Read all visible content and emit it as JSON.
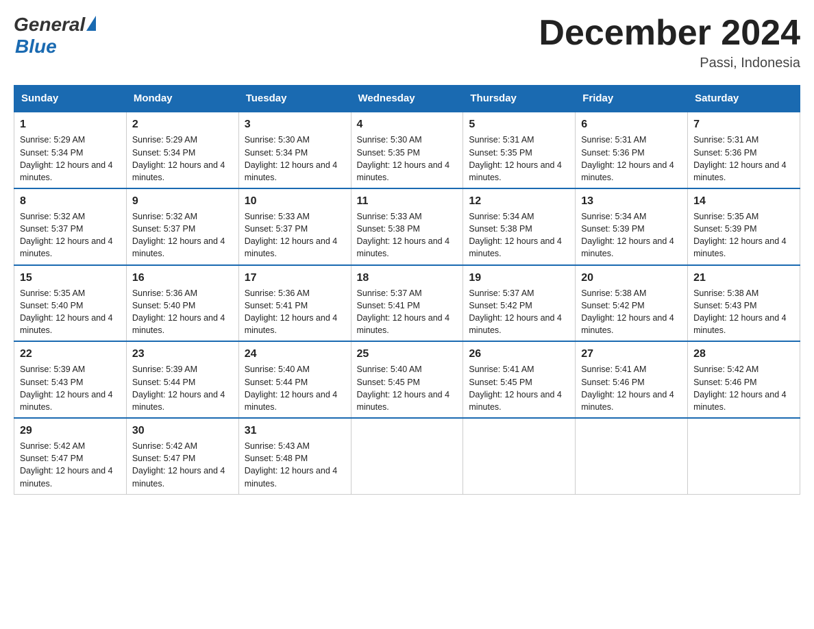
{
  "header": {
    "logo_general": "General",
    "logo_blue": "Blue",
    "month_title": "December 2024",
    "location": "Passi, Indonesia"
  },
  "days_of_week": [
    "Sunday",
    "Monday",
    "Tuesday",
    "Wednesday",
    "Thursday",
    "Friday",
    "Saturday"
  ],
  "weeks": [
    [
      {
        "day": "1",
        "sunrise": "5:29 AM",
        "sunset": "5:34 PM",
        "daylight": "12 hours and 4 minutes."
      },
      {
        "day": "2",
        "sunrise": "5:29 AM",
        "sunset": "5:34 PM",
        "daylight": "12 hours and 4 minutes."
      },
      {
        "day": "3",
        "sunrise": "5:30 AM",
        "sunset": "5:34 PM",
        "daylight": "12 hours and 4 minutes."
      },
      {
        "day": "4",
        "sunrise": "5:30 AM",
        "sunset": "5:35 PM",
        "daylight": "12 hours and 4 minutes."
      },
      {
        "day": "5",
        "sunrise": "5:31 AM",
        "sunset": "5:35 PM",
        "daylight": "12 hours and 4 minutes."
      },
      {
        "day": "6",
        "sunrise": "5:31 AM",
        "sunset": "5:36 PM",
        "daylight": "12 hours and 4 minutes."
      },
      {
        "day": "7",
        "sunrise": "5:31 AM",
        "sunset": "5:36 PM",
        "daylight": "12 hours and 4 minutes."
      }
    ],
    [
      {
        "day": "8",
        "sunrise": "5:32 AM",
        "sunset": "5:37 PM",
        "daylight": "12 hours and 4 minutes."
      },
      {
        "day": "9",
        "sunrise": "5:32 AM",
        "sunset": "5:37 PM",
        "daylight": "12 hours and 4 minutes."
      },
      {
        "day": "10",
        "sunrise": "5:33 AM",
        "sunset": "5:37 PM",
        "daylight": "12 hours and 4 minutes."
      },
      {
        "day": "11",
        "sunrise": "5:33 AM",
        "sunset": "5:38 PM",
        "daylight": "12 hours and 4 minutes."
      },
      {
        "day": "12",
        "sunrise": "5:34 AM",
        "sunset": "5:38 PM",
        "daylight": "12 hours and 4 minutes."
      },
      {
        "day": "13",
        "sunrise": "5:34 AM",
        "sunset": "5:39 PM",
        "daylight": "12 hours and 4 minutes."
      },
      {
        "day": "14",
        "sunrise": "5:35 AM",
        "sunset": "5:39 PM",
        "daylight": "12 hours and 4 minutes."
      }
    ],
    [
      {
        "day": "15",
        "sunrise": "5:35 AM",
        "sunset": "5:40 PM",
        "daylight": "12 hours and 4 minutes."
      },
      {
        "day": "16",
        "sunrise": "5:36 AM",
        "sunset": "5:40 PM",
        "daylight": "12 hours and 4 minutes."
      },
      {
        "day": "17",
        "sunrise": "5:36 AM",
        "sunset": "5:41 PM",
        "daylight": "12 hours and 4 minutes."
      },
      {
        "day": "18",
        "sunrise": "5:37 AM",
        "sunset": "5:41 PM",
        "daylight": "12 hours and 4 minutes."
      },
      {
        "day": "19",
        "sunrise": "5:37 AM",
        "sunset": "5:42 PM",
        "daylight": "12 hours and 4 minutes."
      },
      {
        "day": "20",
        "sunrise": "5:38 AM",
        "sunset": "5:42 PM",
        "daylight": "12 hours and 4 minutes."
      },
      {
        "day": "21",
        "sunrise": "5:38 AM",
        "sunset": "5:43 PM",
        "daylight": "12 hours and 4 minutes."
      }
    ],
    [
      {
        "day": "22",
        "sunrise": "5:39 AM",
        "sunset": "5:43 PM",
        "daylight": "12 hours and 4 minutes."
      },
      {
        "day": "23",
        "sunrise": "5:39 AM",
        "sunset": "5:44 PM",
        "daylight": "12 hours and 4 minutes."
      },
      {
        "day": "24",
        "sunrise": "5:40 AM",
        "sunset": "5:44 PM",
        "daylight": "12 hours and 4 minutes."
      },
      {
        "day": "25",
        "sunrise": "5:40 AM",
        "sunset": "5:45 PM",
        "daylight": "12 hours and 4 minutes."
      },
      {
        "day": "26",
        "sunrise": "5:41 AM",
        "sunset": "5:45 PM",
        "daylight": "12 hours and 4 minutes."
      },
      {
        "day": "27",
        "sunrise": "5:41 AM",
        "sunset": "5:46 PM",
        "daylight": "12 hours and 4 minutes."
      },
      {
        "day": "28",
        "sunrise": "5:42 AM",
        "sunset": "5:46 PM",
        "daylight": "12 hours and 4 minutes."
      }
    ],
    [
      {
        "day": "29",
        "sunrise": "5:42 AM",
        "sunset": "5:47 PM",
        "daylight": "12 hours and 4 minutes."
      },
      {
        "day": "30",
        "sunrise": "5:42 AM",
        "sunset": "5:47 PM",
        "daylight": "12 hours and 4 minutes."
      },
      {
        "day": "31",
        "sunrise": "5:43 AM",
        "sunset": "5:48 PM",
        "daylight": "12 hours and 4 minutes."
      },
      null,
      null,
      null,
      null
    ]
  ]
}
